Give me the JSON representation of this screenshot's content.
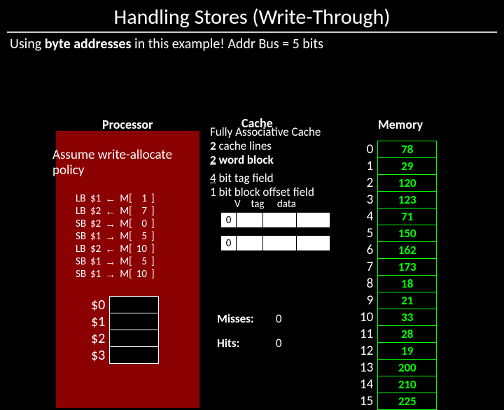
{
  "title": "Handling Stores (Write-Through)",
  "subtitle_pre": "Using ",
  "subtitle_bold": "byte addresses",
  "subtitle_post": " in this example! Addr Bus = 5 bits",
  "headings": {
    "processor": "Processor",
    "cache": "Cache",
    "memory": "Memory"
  },
  "assume_l1": "Assume write-allocate",
  "assume_l2": "policy",
  "instructions": [
    {
      "op": "LB",
      "rd": "$1",
      "dir": "←",
      "addr": "1"
    },
    {
      "op": "LB",
      "rd": "$2",
      "dir": "←",
      "addr": "7"
    },
    {
      "op": "SB",
      "rd": "$2",
      "dir": "→",
      "addr": "0"
    },
    {
      "op": "SB",
      "rd": "$1",
      "dir": "→",
      "addr": "5"
    },
    {
      "op": "LB",
      "rd": "$2",
      "dir": "←",
      "addr": "10"
    },
    {
      "op": "SB",
      "rd": "$1",
      "dir": "→",
      "addr": "5"
    },
    {
      "op": "SB",
      "rd": "$1",
      "dir": "→",
      "addr": "10"
    }
  ],
  "registers": [
    "$0",
    "$1",
    "$2",
    "$3"
  ],
  "cache_desc": {
    "l1": "Fully Associative Cache",
    "l2a": "2",
    "l2b": " cache lines",
    "l3a": "2",
    "l3b": " word block",
    "l4a": "4",
    "l4b": " bit tag field",
    "l5": "1 bit block offset field"
  },
  "cache_cols": {
    "v": "V",
    "tag": "tag",
    "data": "data"
  },
  "cache_lines": [
    {
      "v": "0"
    },
    {
      "v": "0"
    }
  ],
  "stats": {
    "misses_label": "Misses:",
    "misses": "0",
    "hits_label": "Hits:",
    "hits": "0"
  },
  "memory": [
    {
      "addr": "0",
      "val": "78"
    },
    {
      "addr": "1",
      "val": "29"
    },
    {
      "addr": "2",
      "val": "120"
    },
    {
      "addr": "3",
      "val": "123"
    },
    {
      "addr": "4",
      "val": "71"
    },
    {
      "addr": "5",
      "val": "150"
    },
    {
      "addr": "6",
      "val": "162"
    },
    {
      "addr": "7",
      "val": "173"
    },
    {
      "addr": "8",
      "val": "18"
    },
    {
      "addr": "9",
      "val": "21"
    },
    {
      "addr": "10",
      "val": "33"
    },
    {
      "addr": "11",
      "val": "28"
    },
    {
      "addr": "12",
      "val": "19"
    },
    {
      "addr": "13",
      "val": "200"
    },
    {
      "addr": "14",
      "val": "210"
    },
    {
      "addr": "15",
      "val": "225"
    }
  ],
  "chart_data": {
    "type": "table",
    "title": "Handling Stores (Write-Through)",
    "memory": [
      {
        "addr": 0,
        "val": 78
      },
      {
        "addr": 1,
        "val": 29
      },
      {
        "addr": 2,
        "val": 120
      },
      {
        "addr": 3,
        "val": 123
      },
      {
        "addr": 4,
        "val": 71
      },
      {
        "addr": 5,
        "val": 150
      },
      {
        "addr": 6,
        "val": 162
      },
      {
        "addr": 7,
        "val": 173
      },
      {
        "addr": 8,
        "val": 18
      },
      {
        "addr": 9,
        "val": 21
      },
      {
        "addr": 10,
        "val": 33
      },
      {
        "addr": 11,
        "val": 28
      },
      {
        "addr": 12,
        "val": 19
      },
      {
        "addr": 13,
        "val": 200
      },
      {
        "addr": 14,
        "val": 210
      },
      {
        "addr": 15,
        "val": 225
      }
    ],
    "hits": 0,
    "misses": 0
  }
}
